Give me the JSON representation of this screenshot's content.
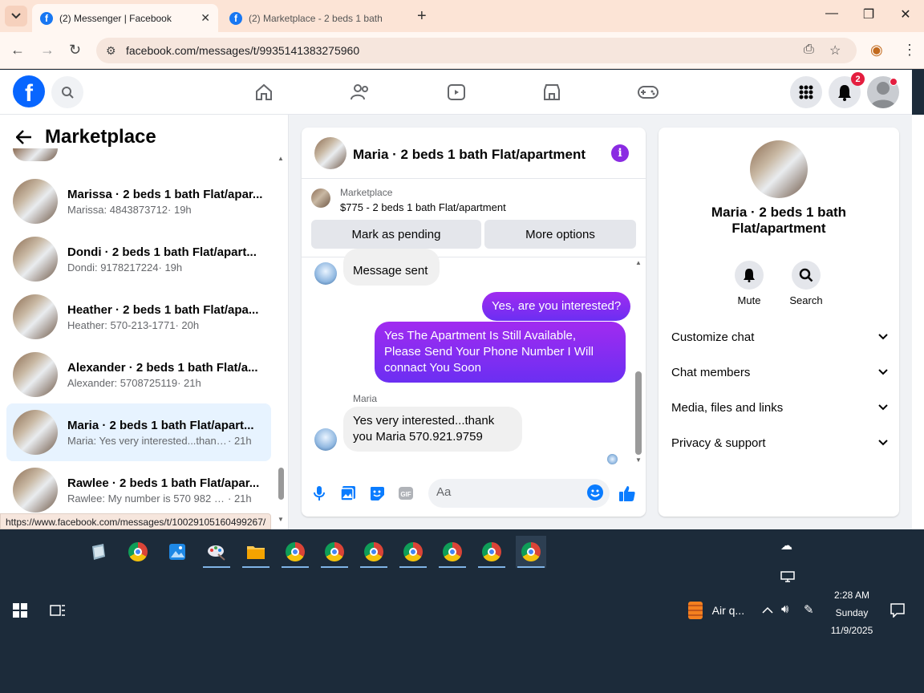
{
  "browser": {
    "tabs": [
      {
        "title": "(2) Messenger | Facebook",
        "active": true
      },
      {
        "title": "(2) Marketplace - 2 beds 1 bath",
        "active": false
      }
    ],
    "url": "facebook.com/messages/t/9935141383275960",
    "status_url": "https://www.facebook.com/messages/t/10029105160499267/"
  },
  "fb_header": {
    "notification_count": "2"
  },
  "left_panel": {
    "title": "Marketplace",
    "conversations": [
      {
        "name": "Marissa · 2 beds 1 bath Flat/apar...",
        "snippet": "Marissa: 4843873712",
        "time": "· 19h",
        "selected": false
      },
      {
        "name": "Dondi · 2 beds 1 bath Flat/apart...",
        "snippet": "Dondi: 9178217224",
        "time": "· 19h",
        "selected": false
      },
      {
        "name": "Heather · 2 beds 1 bath Flat/apa...",
        "snippet": "Heather: 570-213-1771",
        "time": "· 20h",
        "selected": false
      },
      {
        "name": "Alexander · 2 beds 1 bath Flat/a...",
        "snippet": "Alexander: 5708725119",
        "time": "· 21h",
        "selected": false
      },
      {
        "name": "Maria · 2 beds 1 bath Flat/apart...",
        "snippet": "Maria: Yes very interested...thank y...",
        "time": "· 21h",
        "selected": true
      },
      {
        "name": "Rawlee · 2 beds 1 bath Flat/apar...",
        "snippet": "Rawlee: My number is 570 982 98...",
        "time": "· 21h",
        "selected": false
      }
    ]
  },
  "chat": {
    "title": "Maria · 2 beds 1 bath Flat/apartment",
    "marketplace_label": "Marketplace",
    "listing": "$775 - 2 beds 1 bath Flat/apartment",
    "mark_pending_label": "Mark as pending",
    "more_options_label": "More options",
    "messages": {
      "in1": "Message sent",
      "out1": "Yes, are you interested?",
      "out2": "Yes The Apartment Is Still Available, Please Send Your Phone Number I Will connact You Soon",
      "sender": "Maria",
      "in2": "Yes very interested...thank you Maria 570.921.9759"
    },
    "input_placeholder": "Aa"
  },
  "right_panel": {
    "name": "Maria · 2 beds 1 bath Flat/apartment",
    "mute_label": "Mute",
    "search_label": "Search",
    "sections": [
      "Customize chat",
      "Chat members",
      "Media, files and links",
      "Privacy & support"
    ]
  },
  "taskbar": {
    "weather": "Air q...",
    "time": "2:28 AM",
    "day": "Sunday",
    "date": "11/9/2025"
  },
  "colors": {
    "fb_blue": "#0866ff",
    "bubble_out": "#7b2ff2",
    "selected_bg": "#e7f3ff"
  }
}
